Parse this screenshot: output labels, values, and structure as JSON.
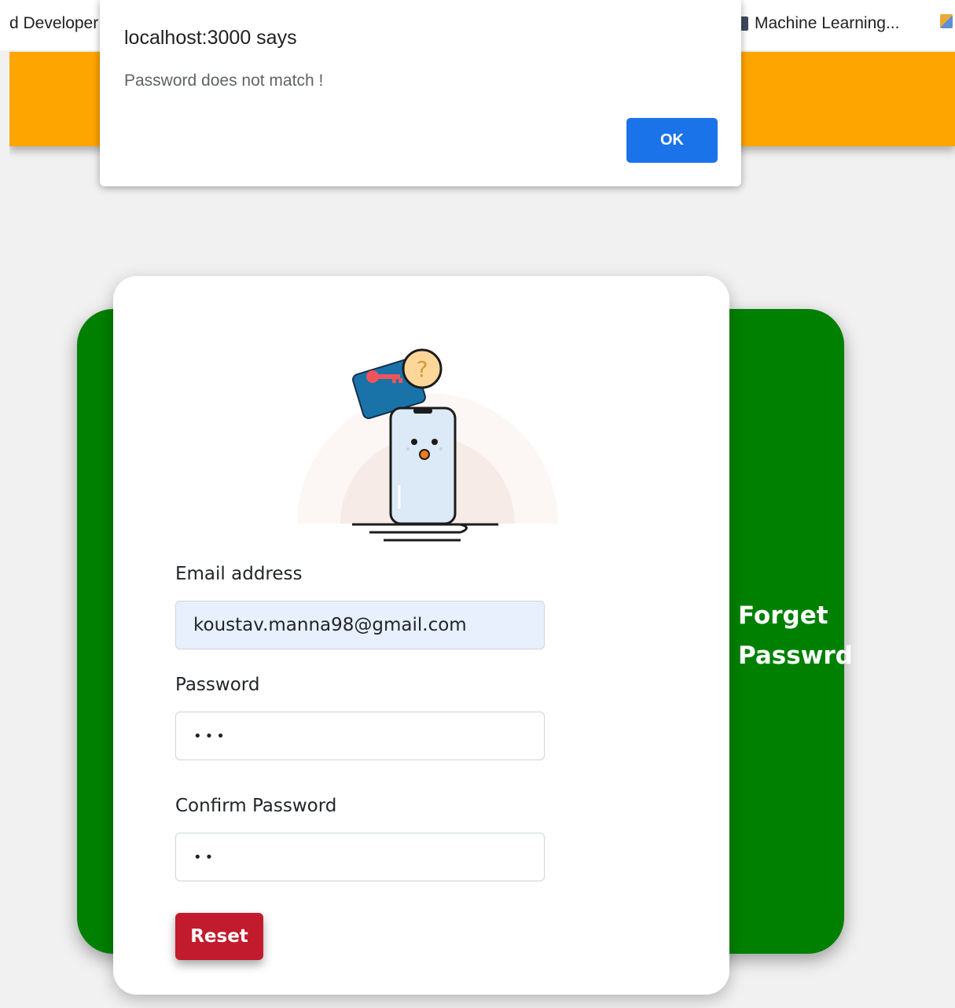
{
  "bookmarks": [
    {
      "label": "d Developer"
    },
    {
      "label": "Machine Learning..."
    }
  ],
  "alert": {
    "title": "localhost:3000 says",
    "message": "Password does not match !",
    "ok_label": "OK"
  },
  "card": {
    "side_title_line1": "Forget",
    "side_title_line2": "Passwrd"
  },
  "form": {
    "email_label": "Email address",
    "email_value": "koustav.manna98@gmail.com",
    "password_label": "Password",
    "password_value": "•••",
    "confirm_label": "Confirm Password",
    "confirm_value": "••",
    "reset_label": "Reset"
  },
  "colors": {
    "navbar": "#ffa500",
    "green_card": "#008000",
    "reset_button": "#c21b2d",
    "ok_button": "#1a73e8",
    "autofill_bg": "#e8f0fe"
  }
}
